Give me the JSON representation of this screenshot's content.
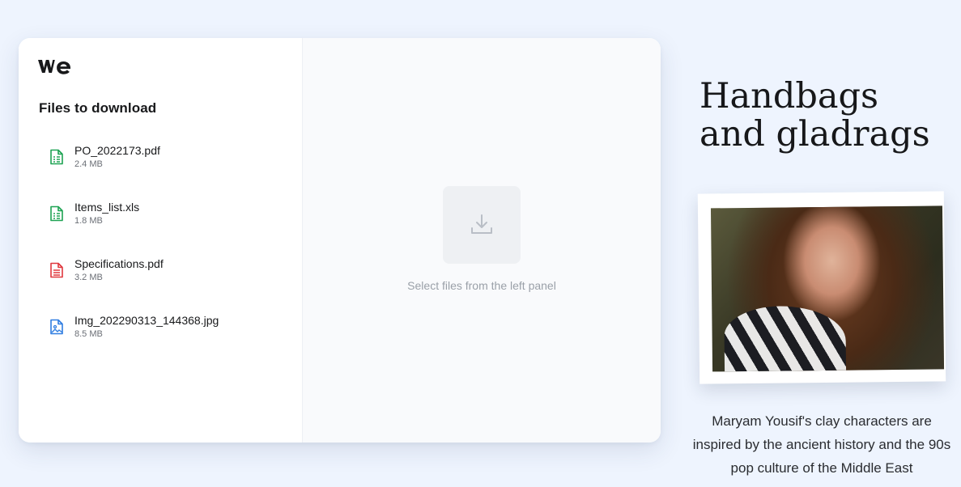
{
  "logo": {
    "name": "we-logo",
    "color": "#17181a"
  },
  "left_panel": {
    "title": "Files to download",
    "files": [
      {
        "name": "PO_2022173.pdf",
        "size": "2.4 MB",
        "icon": "spreadsheet-icon",
        "color": "#1ea353"
      },
      {
        "name": "Items_list.xls",
        "size": "1.8 MB",
        "icon": "spreadsheet-icon",
        "color": "#1ea353"
      },
      {
        "name": "Specifications.pdf",
        "size": "3.2 MB",
        "icon": "document-icon",
        "color": "#e0383e"
      },
      {
        "name": "Img_202290313_144368.jpg",
        "size": "8.5 MB",
        "icon": "image-icon",
        "color": "#2f7de1"
      }
    ]
  },
  "right_panel": {
    "empty_icon": "download-icon",
    "empty_text": "Select files from the left panel"
  },
  "promo": {
    "headline_line1": "Handbags",
    "headline_line2": "and gladrags",
    "caption": "Maryam Yousif's clay characters are inspired by the ancient history and the 90s pop culture of the Middle East"
  }
}
